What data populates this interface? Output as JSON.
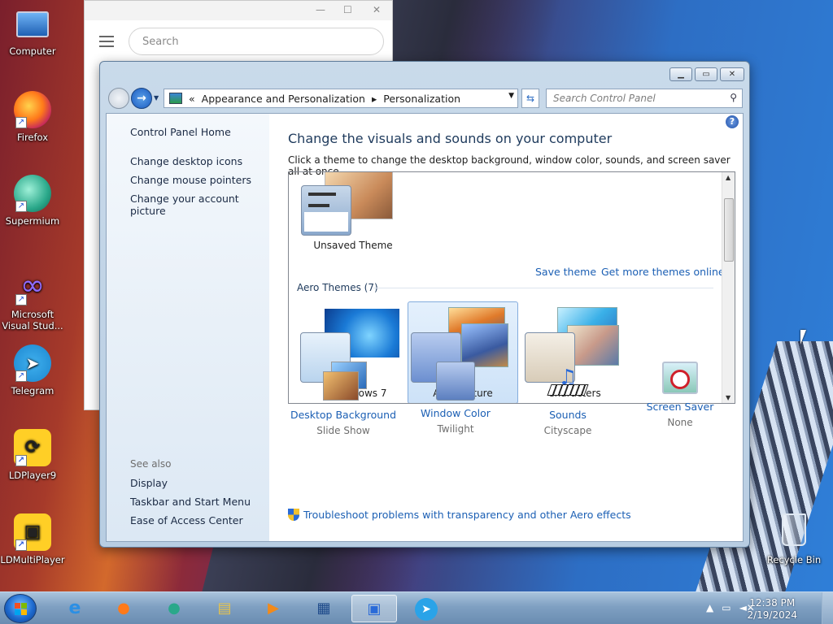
{
  "desktop": {
    "icons": [
      {
        "label": "Computer"
      },
      {
        "label": "Firefox"
      },
      {
        "label": "Supermium"
      },
      {
        "label": "Microsoft Visual Stud..."
      },
      {
        "label": "Telegram"
      },
      {
        "label": "LDPlayer9"
      },
      {
        "label": "LDMultiPlayer"
      }
    ],
    "recycle_bin": "Recycle Bin"
  },
  "browser": {
    "search_placeholder": "Search"
  },
  "window": {
    "breadcrumb_prefix": "«",
    "breadcrumb": [
      "Appearance and Personalization",
      "Personalization"
    ],
    "search_placeholder": "Search Control Panel",
    "left_nav": {
      "home": "Control Panel Home",
      "links": [
        "Change desktop icons",
        "Change mouse pointers",
        "Change your account picture"
      ],
      "see_also_title": "See also",
      "see_also": [
        "Display",
        "Taskbar and Start Menu",
        "Ease of Access Center"
      ]
    },
    "title": "Change the visuals and sounds on your computer",
    "subtitle": "Click a theme to change the desktop background, window color, sounds, and screen saver all at once.",
    "unsaved_theme": "Unsaved Theme",
    "save_theme": "Save theme",
    "get_more": "Get more themes online",
    "group_title": "Aero Themes (7)",
    "aero_themes": [
      "Windows 7",
      "Architecture",
      "Characters"
    ],
    "selected_theme": "Architecture",
    "customize": [
      {
        "label": "Desktop Background",
        "value": "Slide Show"
      },
      {
        "label": "Window Color",
        "value": "Twilight"
      },
      {
        "label": "Sounds",
        "value": "Cityscape"
      },
      {
        "label": "Screen Saver",
        "value": "None"
      }
    ],
    "troubleshoot": "Troubleshoot problems with transparency and other Aero effects"
  },
  "taskbar": {
    "time": "12:38 PM",
    "date": "2/19/2024"
  }
}
